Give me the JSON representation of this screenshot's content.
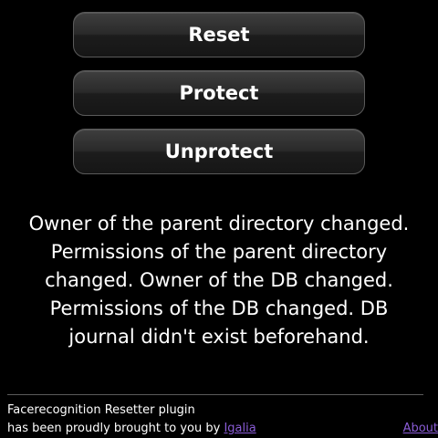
{
  "buttons": {
    "reset": "Reset",
    "protect": "Protect",
    "unprotect": "Unprotect"
  },
  "status": {
    "message": "Owner of the parent directory changed. Permissions of the parent directory changed. Owner of the DB changed. Permissions of the DB changed. DB journal didn't exist beforehand."
  },
  "footer": {
    "line1": "Facerecognition Resetter plugin",
    "line2_prefix": "has been proudly brought to you by ",
    "author_link": "Igalia",
    "about_link": "About"
  },
  "colors": {
    "background": "#000000",
    "text": "#ffffff",
    "link": "#8a5cd6"
  }
}
